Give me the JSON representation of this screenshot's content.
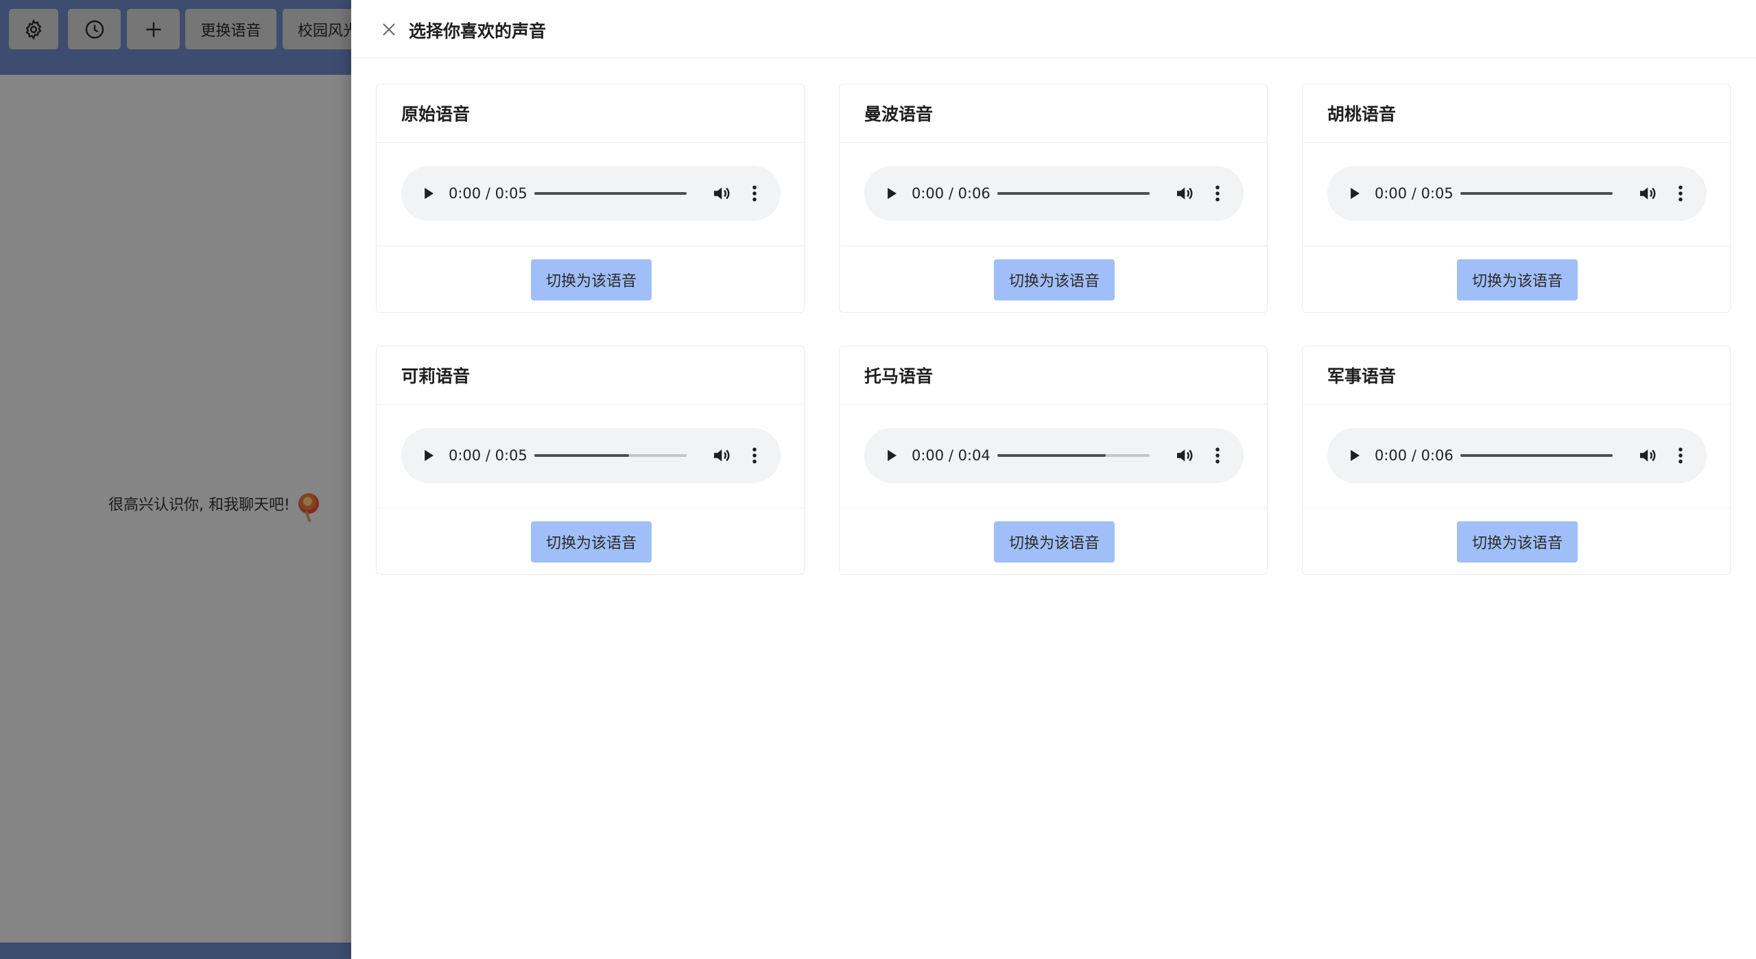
{
  "app": {
    "toolbar": {
      "settings_icon": "gear-icon",
      "history_icon": "clock-icon",
      "new_icon": "plus-icon",
      "change_voice_label": "更换语音",
      "campus_label": "校园风光"
    },
    "welcome_text": "很高兴认识你, 和我聊天吧!"
  },
  "drawer": {
    "title": "选择你喜欢的声音",
    "close_icon": "close-icon",
    "voices": [
      {
        "name": "原始语音",
        "time": "0:00 / 0:05",
        "progress": 1.0,
        "button_label": "切换为该语音"
      },
      {
        "name": "曼波语音",
        "time": "0:00 / 0:06",
        "progress": 1.0,
        "button_label": "切换为该语音"
      },
      {
        "name": "胡桃语音",
        "time": "0:00 / 0:05",
        "progress": 1.0,
        "button_label": "切换为该语音"
      },
      {
        "name": "可莉语音",
        "time": "0:00 / 0:05",
        "progress": 0.62,
        "button_label": "切换为该语音"
      },
      {
        "name": "托马语音",
        "time": "0:00 / 0:04",
        "progress": 0.71,
        "button_label": "切换为该语音"
      },
      {
        "name": "军事语音",
        "time": "0:00 / 0:06",
        "progress": 1.0,
        "button_label": "切换为该语音"
      }
    ]
  },
  "colors": {
    "header_bg": "#6d8ccc",
    "button_accent": "#a0bff8",
    "player_bg": "#f1f3f4"
  }
}
